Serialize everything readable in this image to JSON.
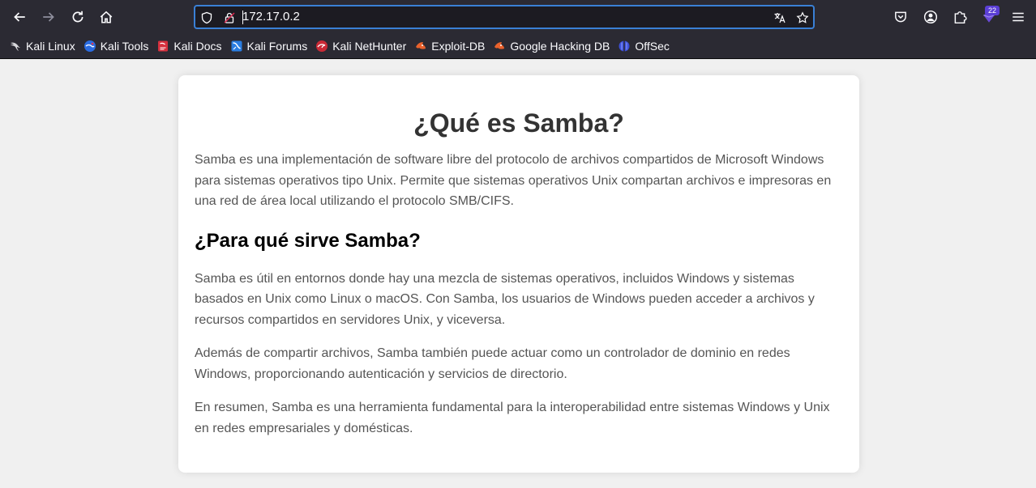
{
  "browser": {
    "url": "172.17.0.2",
    "extensions_badge": "22",
    "bookmarks": [
      {
        "label": "Kali Linux",
        "icon": "kali-dragon-icon"
      },
      {
        "label": "Kali Tools",
        "icon": "kali-tools-icon"
      },
      {
        "label": "Kali Docs",
        "icon": "kali-docs-icon"
      },
      {
        "label": "Kali Forums",
        "icon": "kali-forums-icon"
      },
      {
        "label": "Kali NetHunter",
        "icon": "kali-nethunter-icon"
      },
      {
        "label": "Exploit-DB",
        "icon": "exploit-db-icon"
      },
      {
        "label": "Google Hacking DB",
        "icon": "ghdb-icon"
      },
      {
        "label": "OffSec",
        "icon": "offsec-icon"
      }
    ]
  },
  "page": {
    "title": "¿Qué es Samba?",
    "intro": "Samba es una implementación de software libre del protocolo de archivos compartidos de Microsoft Windows para sistemas operativos tipo Unix. Permite que sistemas operativos Unix compartan archivos e impresoras en una red de área local utilizando el protocolo SMB/CIFS.",
    "subtitle": "¿Para qué sirve Samba?",
    "paragraphs": [
      "Samba es útil en entornos donde hay una mezcla de sistemas operativos, incluidos Windows y sistemas basados en Unix como Linux o macOS. Con Samba, los usuarios de Windows pueden acceder a archivos y recursos compartidos en servidores Unix, y viceversa.",
      "Además de compartir archivos, Samba también puede actuar como un controlador de dominio en redes Windows, proporcionando autenticación y servicios de directorio.",
      "En resumen, Samba es una herramienta fundamental para la interoperabilidad entre sistemas Windows y Unix en redes empresariales y domésticas."
    ]
  },
  "colors": {
    "chrome_bg": "#2b2a33",
    "urlbar_bg": "#1c1b22",
    "urlbar_focus": "#3a80d6",
    "page_bg": "#f0f0f0",
    "card_bg": "#ffffff",
    "heading": "#333333",
    "body_text": "#555555"
  }
}
